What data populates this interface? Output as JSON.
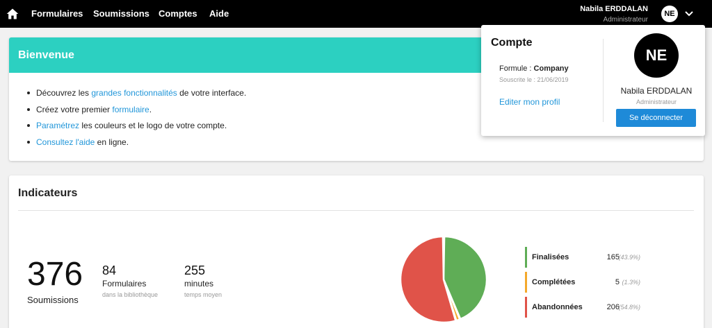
{
  "nav": {
    "items": [
      "Formulaires",
      "Soumissions",
      "Comptes",
      "Aide"
    ],
    "user_name": "Nabila ERDDALAN",
    "user_role": "Administrateur",
    "avatar_initials": "NE"
  },
  "welcome": {
    "title": "Bienvenue",
    "items": [
      {
        "before": "Découvrez les ",
        "link": "grandes fonctionnalités",
        "after": " de votre interface."
      },
      {
        "before": "Créez votre premier ",
        "link": "formulaire",
        "after": "."
      },
      {
        "before": "",
        "link": "Paramétrez",
        "after": " les couleurs et le logo de votre compte."
      },
      {
        "before": "",
        "link": "Consultez l'aide",
        "after": " en ligne."
      }
    ]
  },
  "indicators": {
    "title": "Indicateurs",
    "submissions_value": "376",
    "submissions_label": "Soumissions",
    "forms_value": "84",
    "forms_label": "Formulaires",
    "forms_sub": "dans la bibliothèque",
    "minutes_value": "255",
    "minutes_label": "minutes",
    "minutes_sub": "temps moyen"
  },
  "chart_data": {
    "type": "pie",
    "categories": [
      "Finalisées",
      "Complétées",
      "Abandonnées"
    ],
    "values": [
      165,
      5,
      206
    ],
    "percent_labels": [
      "(43.9%)",
      "(1.3%)",
      "(54.8%)"
    ],
    "colors": [
      "#5fad56",
      "#f4a92b",
      "#e05349"
    ]
  },
  "account_dropdown": {
    "title": "Compte",
    "formule_label": "Formule :",
    "formule_value": "Company",
    "subscribed": "Souscrite le : 21/06/2019",
    "edit_profile": "Editer mon profil",
    "avatar_initials": "NE",
    "name": "Nabila ERDDALAN",
    "role": "Administrateur",
    "logout": "Se déconnecter"
  }
}
